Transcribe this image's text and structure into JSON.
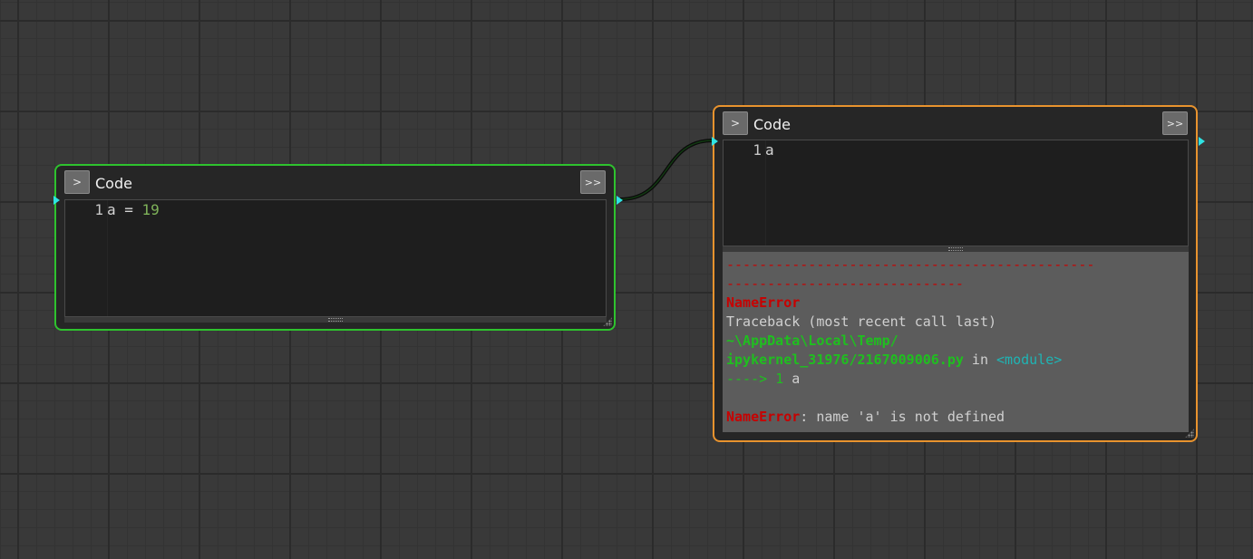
{
  "nodes": [
    {
      "title": "Code",
      "run_label": ">",
      "more_label": ">>",
      "line_number": "1",
      "code": {
        "var": "a",
        "op": " = ",
        "value": "19"
      }
    },
    {
      "title": "Code",
      "run_label": ">",
      "more_label": ">>",
      "line_number": "1",
      "code": {
        "var": "a"
      },
      "output": {
        "dash_line_1": "---------------------------------------------",
        "dash_line_2": "-----------------------------",
        "error_name": "NameError",
        "traceback": "Traceback (most recent call last)",
        "file_line_1": "~\\AppData\\Local\\Temp/",
        "file_line_2": "ipykernel_31976/2167009006.py",
        "in_word": " in ",
        "module": "<module>",
        "arrow": "----> ",
        "arrow_line_number": "1",
        "arrow_code": " a",
        "error_name_2": "NameError",
        "error_message": ": name 'a' is not defined"
      }
    }
  ],
  "colors": {
    "left_border": "#2ec22e",
    "right_border": "#e8932e",
    "port": "#2fe3e3",
    "error": "#c80000",
    "path": "#1fbf1f",
    "module": "#1fb4b4"
  }
}
